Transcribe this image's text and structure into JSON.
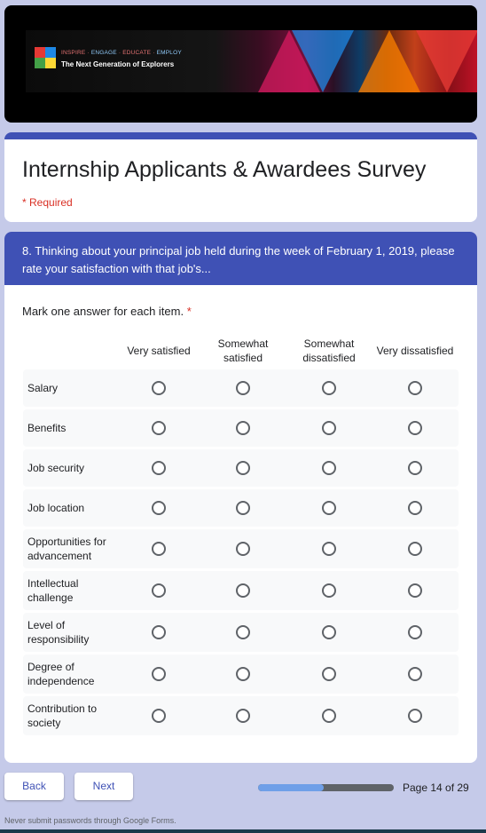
{
  "banner": {
    "tagline": [
      "INSPIRE",
      "ENGAGE",
      "EDUCATE",
      "EMPLOY"
    ],
    "subtitle": "The Next Generation of Explorers",
    "logo_colors": [
      "#e53935",
      "#1e88e5",
      "#43a047",
      "#fdd835"
    ]
  },
  "form": {
    "title": "Internship Applicants & Awardees Survey",
    "required_note": "* Required"
  },
  "section": {
    "title": "8. Thinking about your principal job held during the week of February 1, 2019, please rate your satisfaction with that job's...",
    "question": "Mark one answer for each item.",
    "required_marker": "*",
    "columns": [
      "Very satisfied",
      "Somewhat satisfied",
      "Somewhat dissatisfied",
      "Very dissatisfied"
    ],
    "rows": [
      "Salary",
      "Benefits",
      "Job security",
      "Job location",
      "Opportunities for advancement",
      "Intellectual challenge",
      "Level of responsibility",
      "Degree of independence",
      "Contribution to society"
    ]
  },
  "footer": {
    "back_label": "Back",
    "next_label": "Next",
    "progress": 0.483,
    "page_indicator": "Page 14 of 29",
    "disclaimer": "Never submit passwords through Google Forms."
  },
  "colors": {
    "accent": "#3f51b5",
    "background": "#c5cae9",
    "required": "#d93025",
    "progress_fill": "#6f9fe8"
  }
}
